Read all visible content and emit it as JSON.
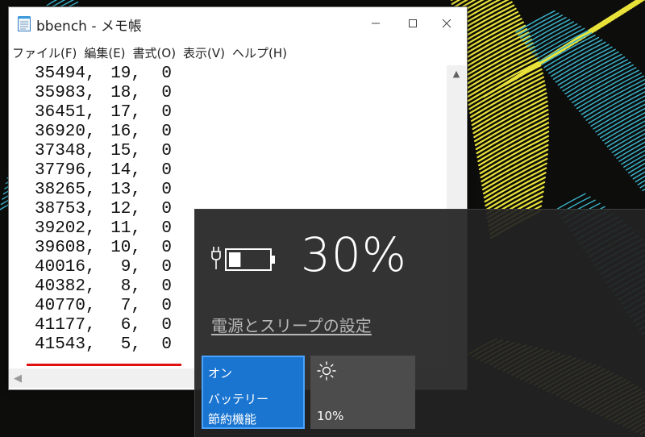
{
  "colors": {
    "flyout_bg": "#242424",
    "saver_tile_active": "#1a75d1",
    "brightness_tile": "#4c4c4c",
    "underline_marker": "#e01010",
    "wallpaper_yellow": "#e8e23a",
    "wallpaper_cyan": "#3ab0c8"
  },
  "notepad": {
    "title": "bbench - メモ帳",
    "menu": [
      "ファイル(F)",
      "編集(E)",
      "書式(O)",
      "表示(V)",
      "ヘルプ(H)"
    ],
    "rows": [
      {
        "c1": "35494,",
        "c2": "19,",
        "c3": "0"
      },
      {
        "c1": "35983,",
        "c2": "18,",
        "c3": "0"
      },
      {
        "c1": "36451,",
        "c2": "17,",
        "c3": "0"
      },
      {
        "c1": "36920,",
        "c2": "16,",
        "c3": "0"
      },
      {
        "c1": "37348,",
        "c2": "15,",
        "c3": "0"
      },
      {
        "c1": "37796,",
        "c2": "14,",
        "c3": "0"
      },
      {
        "c1": "38265,",
        "c2": "13,",
        "c3": "0"
      },
      {
        "c1": "38753,",
        "c2": "12,",
        "c3": "0"
      },
      {
        "c1": "39202,",
        "c2": "11,",
        "c3": "0"
      },
      {
        "c1": "39608,",
        "c2": "10,",
        "c3": "0"
      },
      {
        "c1": "40016,",
        "c2": "9,",
        "c3": "0"
      },
      {
        "c1": "40382,",
        "c2": "8,",
        "c3": "0"
      },
      {
        "c1": "40770,",
        "c2": "7,",
        "c3": "0"
      },
      {
        "c1": "41177,",
        "c2": "6,",
        "c3": "0"
      },
      {
        "c1": "41543,",
        "c2": "5,",
        "c3": "0"
      }
    ],
    "icons": {
      "app": "notepad-icon",
      "minimize": "minimize-icon",
      "maximize": "maximize-icon",
      "close": "close-icon",
      "scroll_up": "chevron-up-icon",
      "scroll_left": "chevron-left-icon"
    }
  },
  "battery": {
    "percent": "30%",
    "charge_level": 0.3,
    "icon": "battery-charging-icon",
    "settings_link": "電源とスリープの設定",
    "saver_tile": {
      "state": "オン",
      "label_line1": "バッテリー",
      "label_line2": "節約機能",
      "active": true
    },
    "brightness_tile": {
      "icon": "sun-icon",
      "level": "10%"
    }
  }
}
